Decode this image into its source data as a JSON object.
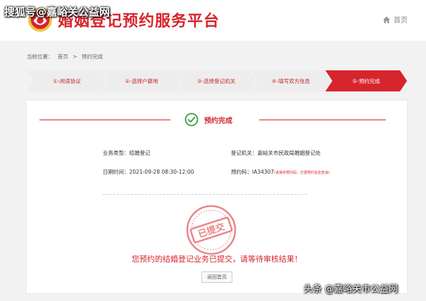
{
  "watermark_top": "搜狐号@嘉峪关公益网",
  "watermark_bottom": "头条 @嘉峪关市公益网",
  "header": {
    "title": "婚姻登记预约服务平台",
    "home_label": "首页"
  },
  "breadcrumb": {
    "prefix": "当前位置：",
    "home": "首页",
    "separator": ">",
    "current": "预约完成"
  },
  "steps": [
    {
      "label": "①-阅读协议",
      "active": false
    },
    {
      "label": "②-选择户籍地",
      "active": false
    },
    {
      "label": "③-选择登记机关",
      "active": false
    },
    {
      "label": "④-填写双方信息",
      "active": false
    },
    {
      "label": "⑤-预约完成",
      "active": true
    }
  ],
  "result": {
    "title": "预约完成",
    "business_type": "业务类型：结婚登记",
    "office": "登记机关：嘉峪关市民政局婚姻登记处",
    "date_time": "日期时间：2021-09-28 08:30-12:00",
    "code": "预约码：IA34307",
    "code_note": "(请保存预约码，方便预约信息查询)",
    "stamp_text": "已提交",
    "message": "您预约的结婚登记业务已提交，请等待审核结果！",
    "back_button": "返回首页"
  },
  "colors": {
    "brand": "#d6252c",
    "step_inactive": "#ededed",
    "step_active": "#d6252c"
  }
}
